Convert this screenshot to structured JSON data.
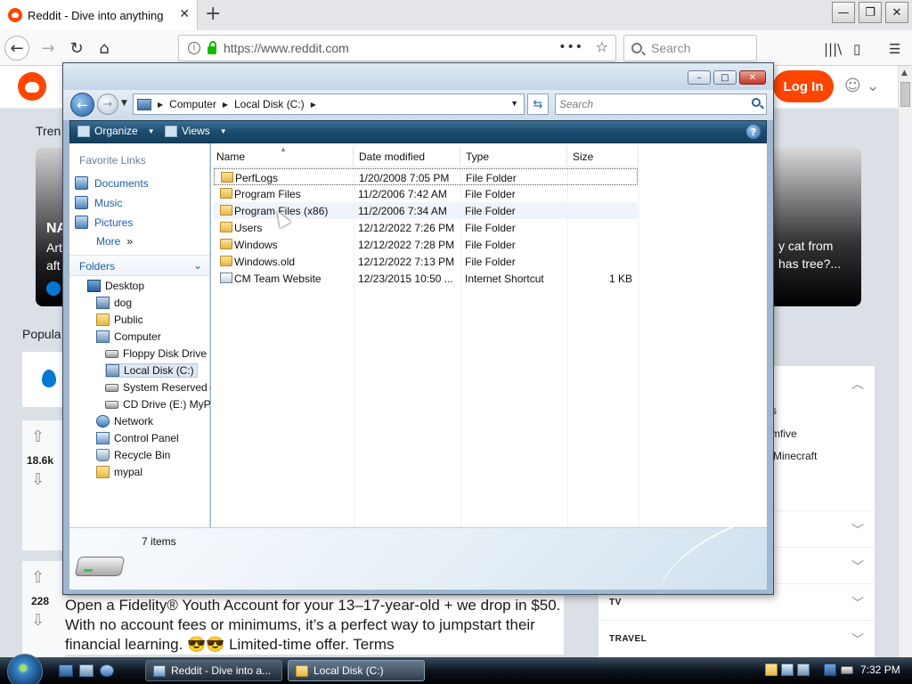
{
  "browser": {
    "tab_title": "Reddit - Dive into anything",
    "tab_close": "✕",
    "new_tab": "+",
    "url": "https://www.reddit.com",
    "search_placeholder": "Search",
    "window_buttons": {
      "minimize": "—",
      "restore": "❐",
      "close": "✕"
    }
  },
  "reddit": {
    "login_label": "Log In",
    "trending_label": "Tren",
    "popular_label": "Popula",
    "card_left": {
      "line1": "NA",
      "line2": "Art",
      "line3": "aft"
    },
    "card_right": {
      "line1": "y cat from",
      "line2": "has tree?..."
    },
    "posts": [
      {
        "votes": "18.6k"
      },
      {
        "votes": "228"
      }
    ],
    "ad_text": "Open a Fidelity® Youth Account for your 13–17-year-old + we drop in $50. With no account fees or minimums, it’s a perfect way to jumpstart their financial learning. 😎😎 Limited-time offer. Terms",
    "side_panel": {
      "fragments": [
        "s",
        "mfive",
        "Minecraft"
      ],
      "sections": [
        "TV",
        "TRAVEL"
      ]
    }
  },
  "explorer": {
    "title_buttons": {
      "minimize": "–",
      "maximize": "□",
      "close": "✕"
    },
    "path": [
      "Computer",
      "Local Disk (C:)"
    ],
    "search_placeholder": "Search",
    "toolbar": {
      "organize": "Organize",
      "views": "Views",
      "help": "?"
    },
    "favorite_links_header": "Favorite Links",
    "favorite_links": [
      "Documents",
      "Music",
      "Pictures",
      "More"
    ],
    "more_chevron": "»",
    "folders_header": "Folders",
    "tree": [
      {
        "label": "Desktop",
        "icon": "desktop-icon"
      },
      {
        "label": "dog",
        "icon": "user-folder-icon"
      },
      {
        "label": "Public",
        "icon": "folder-icon"
      },
      {
        "label": "Computer",
        "icon": "computer-icon"
      },
      {
        "label": "Floppy Disk Drive",
        "icon": "floppy-drive-icon"
      },
      {
        "label": "Local Disk (C:)",
        "icon": "local-disk-icon",
        "selected": true
      },
      {
        "label": "System Reserved (",
        "icon": "drive-icon"
      },
      {
        "label": "CD Drive (E:) MyP",
        "icon": "cd-drive-icon"
      },
      {
        "label": "Network",
        "icon": "network-icon"
      },
      {
        "label": "Control Panel",
        "icon": "control-panel-icon"
      },
      {
        "label": "Recycle Bin",
        "icon": "recycle-bin-icon"
      },
      {
        "label": "mypal",
        "icon": "folder-icon"
      }
    ],
    "columns": [
      "Name",
      "Date modified",
      "Type",
      "Size"
    ],
    "files": [
      {
        "name": "PerfLogs",
        "date": "1/20/2008 7:05 PM",
        "type": "File Folder",
        "size": ""
      },
      {
        "name": "Program Files",
        "date": "11/2/2006 7:42 AM",
        "type": "File Folder",
        "size": ""
      },
      {
        "name": "Program Files (x86)",
        "date": "11/2/2006 7:34 AM",
        "type": "File Folder",
        "size": ""
      },
      {
        "name": "Users",
        "date": "12/12/2022 7:26 PM",
        "type": "File Folder",
        "size": ""
      },
      {
        "name": "Windows",
        "date": "12/12/2022 7:28 PM",
        "type": "File Folder",
        "size": ""
      },
      {
        "name": "Windows.old",
        "date": "12/12/2022 7:13 PM",
        "type": "File Folder",
        "size": ""
      },
      {
        "name": "CM Team Website",
        "date": "12/23/2015 10:50 ...",
        "type": "Internet Shortcut",
        "size": "1 KB"
      }
    ],
    "status_count": "7 items"
  },
  "taskbar": {
    "tasks": [
      "Reddit - Dive into a...",
      "Local Disk (C:)"
    ],
    "clock": "7:32 PM"
  },
  "colors": {
    "reddit_orange": "#ff4500",
    "link_blue": "#1a5fa8",
    "toolbar_blue": "#1c4c6e"
  }
}
